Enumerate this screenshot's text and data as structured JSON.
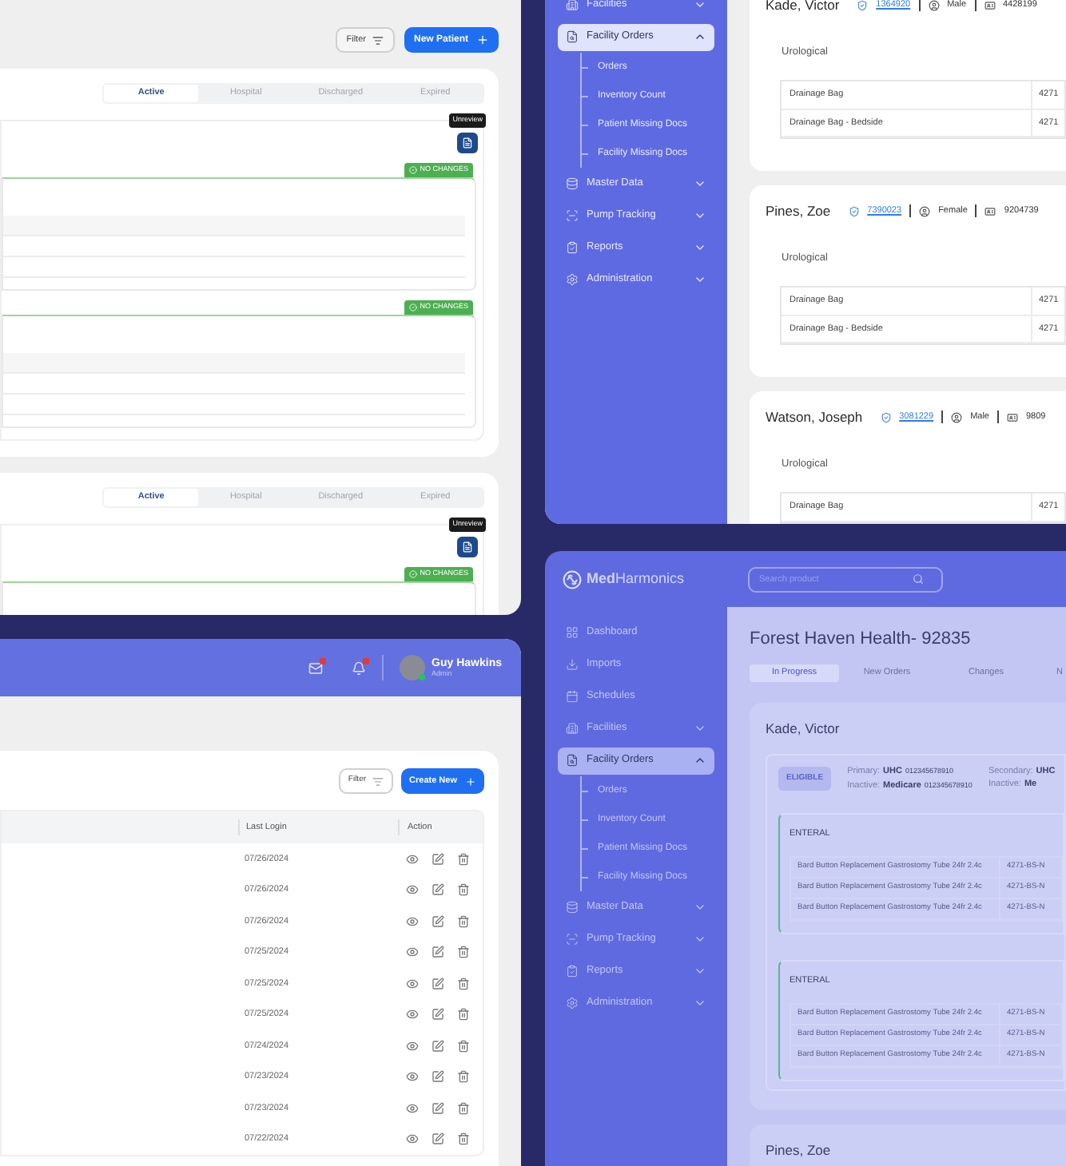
{
  "patients_window": {
    "filter_label": "Filter",
    "new_label": "New Patient",
    "sections": [
      {
        "tabs": [
          {
            "label": "Active",
            "selected": true
          },
          {
            "label": "Hospital",
            "selected": false
          },
          {
            "label": "Discharged",
            "selected": false
          },
          {
            "label": "Expired",
            "selected": false
          }
        ],
        "tooltip": "Unreview",
        "groups": [
          {
            "status": "NO CHANGES"
          },
          {
            "status": "NO CHANGES"
          }
        ]
      },
      {
        "tabs": [
          {
            "label": "Active",
            "selected": true
          },
          {
            "label": "Hospital",
            "selected": false
          },
          {
            "label": "Discharged",
            "selected": false
          },
          {
            "label": "Expired",
            "selected": false
          }
        ],
        "tooltip": "Unreview",
        "groups": [
          {
            "status": "NO CHANGES"
          }
        ]
      }
    ]
  },
  "users_window": {
    "user": {
      "name": "Guy Hawkins",
      "role": "Admin"
    },
    "filter_label": "Filter",
    "create_label": "Create New",
    "columns": [
      "Last Login",
      "Action"
    ],
    "rows": [
      {
        "last_login": "07/26/2024"
      },
      {
        "last_login": "07/26/2024"
      },
      {
        "last_login": "07/26/2024"
      },
      {
        "last_login": "07/25/2024"
      },
      {
        "last_login": "07/25/2024"
      },
      {
        "last_login": "07/25/2024"
      },
      {
        "last_login": "07/24/2024"
      },
      {
        "last_login": "07/23/2024"
      },
      {
        "last_login": "07/23/2024"
      },
      {
        "last_login": "07/22/2024"
      }
    ]
  },
  "orders_window": {
    "sidebar": [
      {
        "label": "Facilities",
        "selected": false,
        "expanded": false
      },
      {
        "label": "Facility Orders",
        "selected": true,
        "expanded": true,
        "children": [
          {
            "label": "Orders",
            "selected": false
          },
          {
            "label": "Inventory Count",
            "selected": false
          },
          {
            "label": "Patient Missing Docs",
            "selected": false
          },
          {
            "label": "Facility Missing Docs",
            "selected": false
          }
        ]
      },
      {
        "label": "Master Data",
        "selected": false,
        "expanded": false
      },
      {
        "label": "Pump Tracking",
        "selected": false,
        "expanded": false
      },
      {
        "label": "Reports",
        "selected": false,
        "expanded": false
      },
      {
        "label": "Administration",
        "selected": false,
        "expanded": false
      }
    ],
    "patients": [
      {
        "name": "Kade, Victor",
        "patient_id": "1364920",
        "gender": "Male",
        "phone": "4428199",
        "category": "Urological",
        "items": [
          {
            "name": "Drainage Bag",
            "code": "4271"
          },
          {
            "name": "Drainage Bag - Bedside",
            "code": "4271"
          }
        ]
      },
      {
        "name": "Pines, Zoe",
        "patient_id": "7390023",
        "gender": "Female",
        "phone": "9204739",
        "category": "Urological",
        "items": [
          {
            "name": "Drainage Bag",
            "code": "4271"
          },
          {
            "name": "Drainage Bag - Bedside",
            "code": "4271"
          }
        ]
      },
      {
        "name": "Watson, Joseph",
        "patient_id": "3081229",
        "gender": "Male",
        "phone": "9809",
        "category": "Urological",
        "items": [
          {
            "name": "Drainage Bag",
            "code": "4271"
          }
        ]
      }
    ]
  },
  "facility_window": {
    "brand": "**Med**Harmonics",
    "search": {
      "placeholder": "Search product"
    },
    "sidebar": [
      {
        "label": "Dashboard",
        "selected": false
      },
      {
        "label": "Imports",
        "selected": false
      },
      {
        "label": "Schedules",
        "selected": false
      },
      {
        "label": "Facilities",
        "selected": false,
        "expanded": false
      },
      {
        "label": "Facility Orders",
        "selected": true,
        "expanded": true,
        "children": [
          {
            "label": "Orders",
            "selected": false
          },
          {
            "label": "Inventory Count",
            "selected": false
          },
          {
            "label": "Patient Missing Docs",
            "selected": false
          },
          {
            "label": "Facility Missing Docs",
            "selected": false
          }
        ]
      },
      {
        "label": "Master Data",
        "selected": false,
        "expanded": false
      },
      {
        "label": "Pump Tracking",
        "selected": false,
        "expanded": false
      },
      {
        "label": "Reports",
        "selected": false,
        "expanded": false
      },
      {
        "label": "Administration",
        "selected": false,
        "expanded": false
      }
    ],
    "title": "Forest Haven Health- 92835",
    "tabs": [
      {
        "label": "In Progress",
        "selected": true
      },
      {
        "label": "New Orders",
        "selected": false
      },
      {
        "label": "Changes",
        "selected": false
      },
      {
        "label": "N",
        "selected": false
      }
    ],
    "patients": [
      {
        "name": "Kade, Victor",
        "eligibility": "ELIGIBLE",
        "coverage": [
          {
            "lines": [
              {
                "label": "Primary:",
                "payer": "UHC",
                "number": "012345678910"
              },
              {
                "label": "Inactive:",
                "payer": "Medicare",
                "number": "012345678910"
              }
            ]
          },
          {
            "lines": [
              {
                "label": "Secondary:",
                "payer": "UHC"
              },
              {
                "label": "Inactive:",
                "payer": "Me"
              }
            ]
          }
        ],
        "groups": [
          {
            "label": "ENTERAL",
            "items": [
              {
                "name": "Bard Button Replacement Gastrostomy Tube 24fr 2.4c",
                "code": "4271-BS-N"
              },
              {
                "name": "Bard Button Replacement Gastrostomy Tube 24fr 2.4c",
                "code": "4271-BS-N"
              },
              {
                "name": "Bard Button Replacement Gastrostomy Tube 24fr 2.4c",
                "code": "4271-BS-N"
              }
            ]
          },
          {
            "label": "ENTERAL",
            "items": [
              {
                "name": "Bard Button Replacement Gastrostomy Tube 24fr 2.4c",
                "code": "4271-BS-N"
              },
              {
                "name": "Bard Button Replacement Gastrostomy Tube 24fr 2.4c",
                "code": "4271-BS-N"
              },
              {
                "name": "Bard Button Replacement Gastrostomy Tube 24fr 2.4c",
                "code": "4271-BS-N"
              }
            ]
          }
        ]
      },
      {
        "name": "Pines, Zoe"
      }
    ]
  }
}
